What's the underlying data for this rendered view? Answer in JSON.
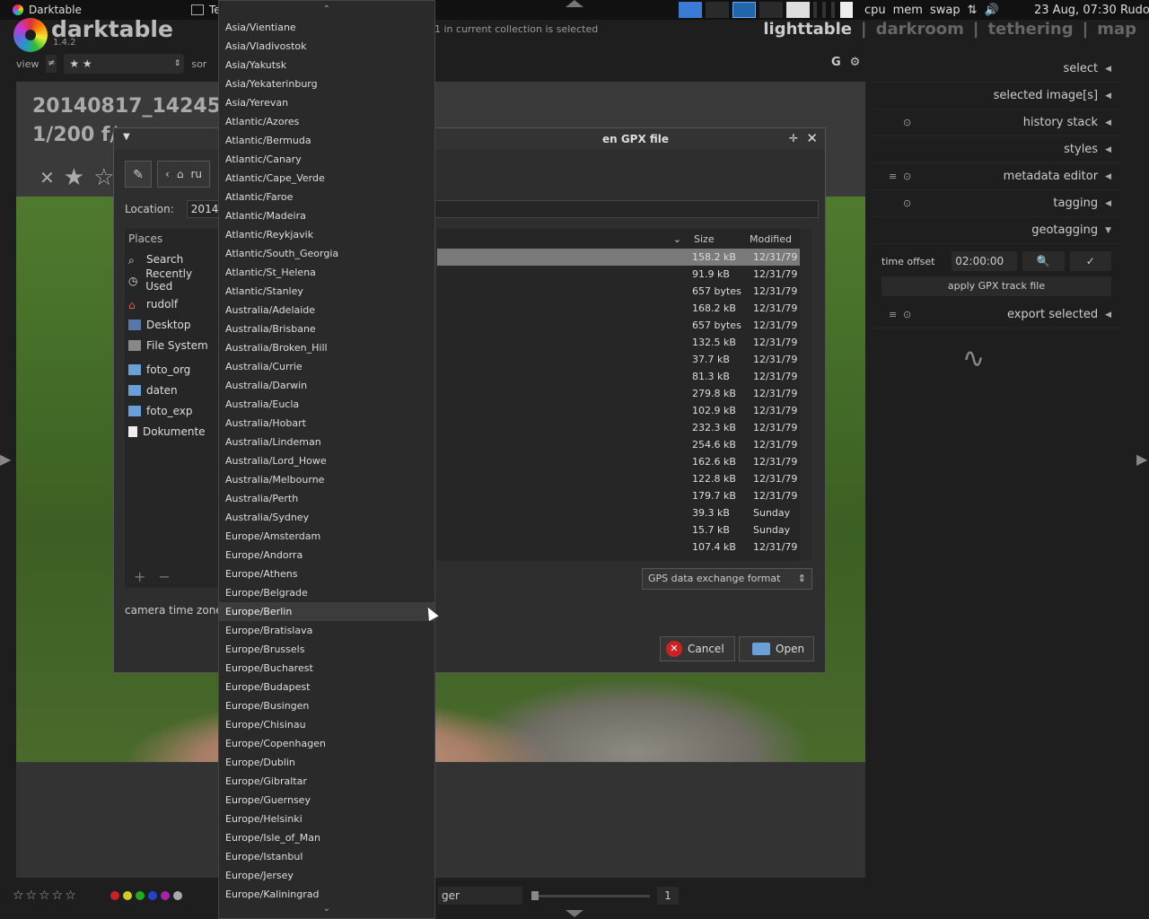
{
  "system_bar": {
    "app_title": "Darktable",
    "terminal_title": "Te",
    "stats": [
      "cpu",
      "mem",
      "swap"
    ],
    "clock": "23 Aug, 07:30",
    "user": "Rudolf"
  },
  "header": {
    "app_name": "darktable",
    "version": "1.4.2",
    "collection_info": "1 in current collection is selected",
    "views": [
      "lighttable",
      "darkroom",
      "tethering",
      "map"
    ],
    "separator": "|"
  },
  "filterbar": {
    "view_label": "view",
    "comparator": "≠",
    "stars_value": "★ ★",
    "sort_label": "sor"
  },
  "top_icons": {
    "grouping": "G",
    "settings_icon": "gear-icon"
  },
  "photo": {
    "title_line1": "20140817_14245",
    "title_line2": "1/200 f/"
  },
  "right_panel": {
    "modules": [
      "select",
      "selected image[s]",
      "history stack",
      "styles",
      "metadata editor",
      "tagging",
      "geotagging",
      "export selected"
    ],
    "geotagging": {
      "time_offset_label": "time offset",
      "time_offset_value": "02:00:00",
      "apply_label": "apply GPX track file"
    }
  },
  "bottombar": {
    "rating": "☆☆☆☆☆",
    "color_labels": [
      "#cc2222",
      "#cccc22",
      "#22aa22",
      "#2244cc",
      "#aa22aa",
      "#aaaaaa"
    ],
    "sort_value": "ger",
    "zoom_value": "1"
  },
  "dialog": {
    "title": "en GPX file",
    "path_crumb": "ru",
    "location_label": "Location:",
    "location_value": "20140",
    "places_header": "Places",
    "places": [
      "Search",
      "Recently Used",
      "rudolf",
      "Desktop",
      "File System",
      "foto_org",
      "daten",
      "foto_exp",
      "Dokumente"
    ],
    "columns": {
      "size": "Size",
      "modified": "Modified"
    },
    "files": [
      {
        "size": "158.2 kB",
        "modified": "12/31/79"
      },
      {
        "size": "91.9 kB",
        "modified": "12/31/79"
      },
      {
        "size": "657 bytes",
        "modified": "12/31/79"
      },
      {
        "size": "168.2 kB",
        "modified": "12/31/79"
      },
      {
        "size": "657 bytes",
        "modified": "12/31/79"
      },
      {
        "size": "132.5 kB",
        "modified": "12/31/79"
      },
      {
        "size": "37.7 kB",
        "modified": "12/31/79"
      },
      {
        "size": "81.3 kB",
        "modified": "12/31/79"
      },
      {
        "size": "279.8 kB",
        "modified": "12/31/79"
      },
      {
        "size": "102.9 kB",
        "modified": "12/31/79"
      },
      {
        "size": "232.3 kB",
        "modified": "12/31/79"
      },
      {
        "size": "254.6 kB",
        "modified": "12/31/79"
      },
      {
        "size": "162.6 kB",
        "modified": "12/31/79"
      },
      {
        "size": "122.8 kB",
        "modified": "12/31/79"
      },
      {
        "size": "179.7 kB",
        "modified": "12/31/79"
      },
      {
        "size": "39.3 kB",
        "modified": "Sunday"
      },
      {
        "size": "15.7 kB",
        "modified": "Sunday"
      },
      {
        "size": "107.4 kB",
        "modified": "12/31/79"
      }
    ],
    "filter_value": "GPS data exchange format",
    "timezone_label": "camera time zone",
    "cancel_label": "Cancel",
    "open_label": "Open"
  },
  "timezone_list": {
    "hovered": "Europe/Berlin",
    "items": [
      "Asia/Vientiane",
      "Asia/Vladivostok",
      "Asia/Yakutsk",
      "Asia/Yekaterinburg",
      "Asia/Yerevan",
      "Atlantic/Azores",
      "Atlantic/Bermuda",
      "Atlantic/Canary",
      "Atlantic/Cape_Verde",
      "Atlantic/Faroe",
      "Atlantic/Madeira",
      "Atlantic/Reykjavik",
      "Atlantic/South_Georgia",
      "Atlantic/St_Helena",
      "Atlantic/Stanley",
      "Australia/Adelaide",
      "Australia/Brisbane",
      "Australia/Broken_Hill",
      "Australia/Currie",
      "Australia/Darwin",
      "Australia/Eucla",
      "Australia/Hobart",
      "Australia/Lindeman",
      "Australia/Lord_Howe",
      "Australia/Melbourne",
      "Australia/Perth",
      "Australia/Sydney",
      "Europe/Amsterdam",
      "Europe/Andorra",
      "Europe/Athens",
      "Europe/Belgrade",
      "Europe/Berlin",
      "Europe/Bratislava",
      "Europe/Brussels",
      "Europe/Bucharest",
      "Europe/Budapest",
      "Europe/Busingen",
      "Europe/Chisinau",
      "Europe/Copenhagen",
      "Europe/Dublin",
      "Europe/Gibraltar",
      "Europe/Guernsey",
      "Europe/Helsinki",
      "Europe/Isle_of_Man",
      "Europe/Istanbul",
      "Europe/Jersey",
      "Europe/Kaliningrad"
    ]
  }
}
